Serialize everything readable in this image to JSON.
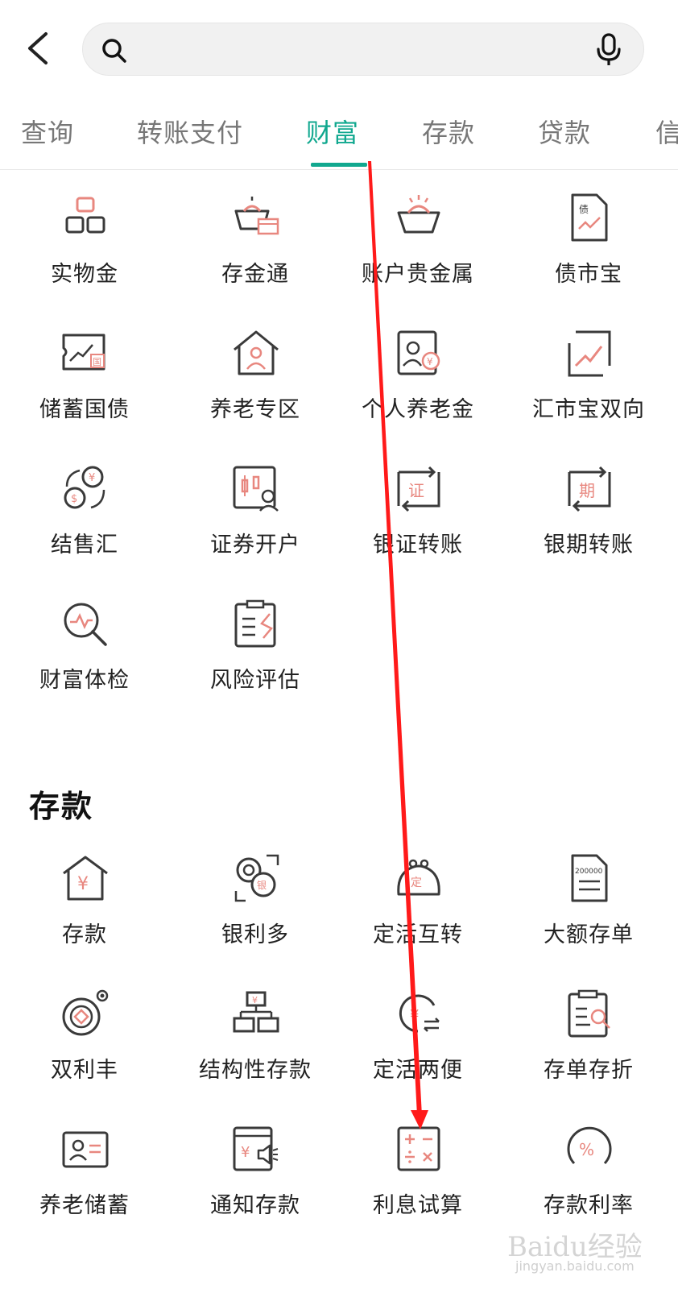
{
  "header": {
    "search_placeholder": ""
  },
  "tabs": [
    {
      "label": "查询",
      "active": false
    },
    {
      "label": "转账支付",
      "active": false
    },
    {
      "label": "财富",
      "active": true
    },
    {
      "label": "存款",
      "active": false
    },
    {
      "label": "贷款",
      "active": false
    },
    {
      "label": "信",
      "active": false
    }
  ],
  "wealth": {
    "items": [
      {
        "label": "实物金",
        "icon": "gold-bar-icon"
      },
      {
        "label": "存金通",
        "icon": "gold-deposit-icon"
      },
      {
        "label": "账户贵金属",
        "icon": "precious-metal-icon"
      },
      {
        "label": "债市宝",
        "icon": "bond-document-icon"
      },
      {
        "label": "储蓄国债",
        "icon": "savings-bond-icon"
      },
      {
        "label": "养老专区",
        "icon": "pension-house-icon"
      },
      {
        "label": "个人养老金",
        "icon": "personal-pension-icon"
      },
      {
        "label": "汇市宝双向",
        "icon": "forex-chart-icon"
      },
      {
        "label": "结售汇",
        "icon": "currency-exchange-icon"
      },
      {
        "label": "证券开户",
        "icon": "securities-account-icon"
      },
      {
        "label": "银证转账",
        "icon": "bank-securities-transfer-icon"
      },
      {
        "label": "银期转账",
        "icon": "bank-futures-transfer-icon"
      },
      {
        "label": "财富体检",
        "icon": "wealth-checkup-icon"
      },
      {
        "label": "风险评估",
        "icon": "risk-assessment-icon"
      }
    ]
  },
  "deposits": {
    "title": "存款",
    "items": [
      {
        "label": "存款",
        "icon": "deposit-house-icon"
      },
      {
        "label": "银利多",
        "icon": "yinliduo-icon"
      },
      {
        "label": "定活互转",
        "icon": "fixed-demand-transfer-icon"
      },
      {
        "label": "大额存单",
        "icon": "large-certificate-icon"
      },
      {
        "label": "双利丰",
        "icon": "shuanglifeng-icon"
      },
      {
        "label": "结构性存款",
        "icon": "structured-deposit-icon"
      },
      {
        "label": "定活两便",
        "icon": "fixed-demand-flexible-icon"
      },
      {
        "label": "存单存折",
        "icon": "certificate-passbook-icon"
      },
      {
        "label": "养老储蓄",
        "icon": "pension-savings-icon"
      },
      {
        "label": "通知存款",
        "icon": "notice-deposit-icon"
      },
      {
        "label": "利息试算",
        "icon": "interest-calculator-icon"
      },
      {
        "label": "存款利率",
        "icon": "deposit-rate-icon"
      }
    ]
  },
  "watermark": {
    "brand": "Baidu经验",
    "url": "jingyan.baidu.com"
  },
  "colors": {
    "accent": "#11a88f",
    "icon_stroke": "#3a3a3a",
    "icon_highlight": "#e8877f",
    "arrow": "#ff1a1a"
  }
}
